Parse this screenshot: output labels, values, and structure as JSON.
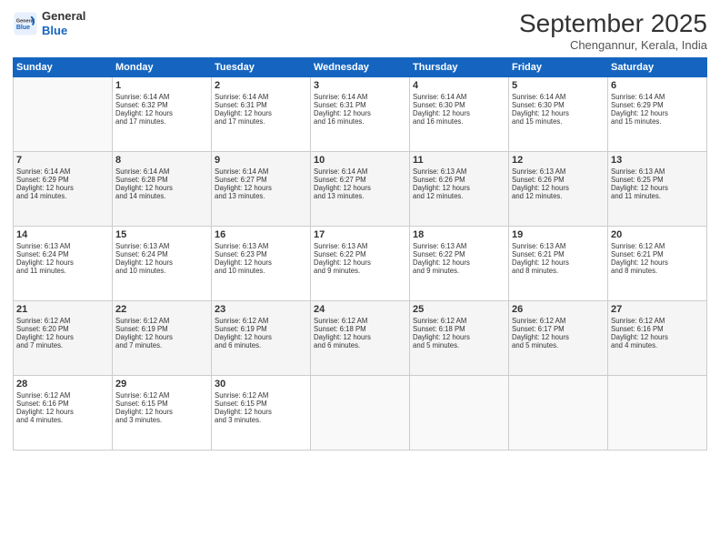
{
  "header": {
    "logo_line1": "General",
    "logo_line2": "Blue",
    "month": "September 2025",
    "location": "Chengannur, Kerala, India"
  },
  "weekdays": [
    "Sunday",
    "Monday",
    "Tuesday",
    "Wednesday",
    "Thursday",
    "Friday",
    "Saturday"
  ],
  "weeks": [
    [
      {
        "day": "",
        "info": ""
      },
      {
        "day": "1",
        "info": "Sunrise: 6:14 AM\nSunset: 6:32 PM\nDaylight: 12 hours\nand 17 minutes."
      },
      {
        "day": "2",
        "info": "Sunrise: 6:14 AM\nSunset: 6:31 PM\nDaylight: 12 hours\nand 17 minutes."
      },
      {
        "day": "3",
        "info": "Sunrise: 6:14 AM\nSunset: 6:31 PM\nDaylight: 12 hours\nand 16 minutes."
      },
      {
        "day": "4",
        "info": "Sunrise: 6:14 AM\nSunset: 6:30 PM\nDaylight: 12 hours\nand 16 minutes."
      },
      {
        "day": "5",
        "info": "Sunrise: 6:14 AM\nSunset: 6:30 PM\nDaylight: 12 hours\nand 15 minutes."
      },
      {
        "day": "6",
        "info": "Sunrise: 6:14 AM\nSunset: 6:29 PM\nDaylight: 12 hours\nand 15 minutes."
      }
    ],
    [
      {
        "day": "7",
        "info": "Sunrise: 6:14 AM\nSunset: 6:29 PM\nDaylight: 12 hours\nand 14 minutes."
      },
      {
        "day": "8",
        "info": "Sunrise: 6:14 AM\nSunset: 6:28 PM\nDaylight: 12 hours\nand 14 minutes."
      },
      {
        "day": "9",
        "info": "Sunrise: 6:14 AM\nSunset: 6:27 PM\nDaylight: 12 hours\nand 13 minutes."
      },
      {
        "day": "10",
        "info": "Sunrise: 6:14 AM\nSunset: 6:27 PM\nDaylight: 12 hours\nand 13 minutes."
      },
      {
        "day": "11",
        "info": "Sunrise: 6:13 AM\nSunset: 6:26 PM\nDaylight: 12 hours\nand 12 minutes."
      },
      {
        "day": "12",
        "info": "Sunrise: 6:13 AM\nSunset: 6:26 PM\nDaylight: 12 hours\nand 12 minutes."
      },
      {
        "day": "13",
        "info": "Sunrise: 6:13 AM\nSunset: 6:25 PM\nDaylight: 12 hours\nand 11 minutes."
      }
    ],
    [
      {
        "day": "14",
        "info": "Sunrise: 6:13 AM\nSunset: 6:24 PM\nDaylight: 12 hours\nand 11 minutes."
      },
      {
        "day": "15",
        "info": "Sunrise: 6:13 AM\nSunset: 6:24 PM\nDaylight: 12 hours\nand 10 minutes."
      },
      {
        "day": "16",
        "info": "Sunrise: 6:13 AM\nSunset: 6:23 PM\nDaylight: 12 hours\nand 10 minutes."
      },
      {
        "day": "17",
        "info": "Sunrise: 6:13 AM\nSunset: 6:22 PM\nDaylight: 12 hours\nand 9 minutes."
      },
      {
        "day": "18",
        "info": "Sunrise: 6:13 AM\nSunset: 6:22 PM\nDaylight: 12 hours\nand 9 minutes."
      },
      {
        "day": "19",
        "info": "Sunrise: 6:13 AM\nSunset: 6:21 PM\nDaylight: 12 hours\nand 8 minutes."
      },
      {
        "day": "20",
        "info": "Sunrise: 6:12 AM\nSunset: 6:21 PM\nDaylight: 12 hours\nand 8 minutes."
      }
    ],
    [
      {
        "day": "21",
        "info": "Sunrise: 6:12 AM\nSunset: 6:20 PM\nDaylight: 12 hours\nand 7 minutes."
      },
      {
        "day": "22",
        "info": "Sunrise: 6:12 AM\nSunset: 6:19 PM\nDaylight: 12 hours\nand 7 minutes."
      },
      {
        "day": "23",
        "info": "Sunrise: 6:12 AM\nSunset: 6:19 PM\nDaylight: 12 hours\nand 6 minutes."
      },
      {
        "day": "24",
        "info": "Sunrise: 6:12 AM\nSunset: 6:18 PM\nDaylight: 12 hours\nand 6 minutes."
      },
      {
        "day": "25",
        "info": "Sunrise: 6:12 AM\nSunset: 6:18 PM\nDaylight: 12 hours\nand 5 minutes."
      },
      {
        "day": "26",
        "info": "Sunrise: 6:12 AM\nSunset: 6:17 PM\nDaylight: 12 hours\nand 5 minutes."
      },
      {
        "day": "27",
        "info": "Sunrise: 6:12 AM\nSunset: 6:16 PM\nDaylight: 12 hours\nand 4 minutes."
      }
    ],
    [
      {
        "day": "28",
        "info": "Sunrise: 6:12 AM\nSunset: 6:16 PM\nDaylight: 12 hours\nand 4 minutes."
      },
      {
        "day": "29",
        "info": "Sunrise: 6:12 AM\nSunset: 6:15 PM\nDaylight: 12 hours\nand 3 minutes."
      },
      {
        "day": "30",
        "info": "Sunrise: 6:12 AM\nSunset: 6:15 PM\nDaylight: 12 hours\nand 3 minutes."
      },
      {
        "day": "",
        "info": ""
      },
      {
        "day": "",
        "info": ""
      },
      {
        "day": "",
        "info": ""
      },
      {
        "day": "",
        "info": ""
      }
    ]
  ]
}
